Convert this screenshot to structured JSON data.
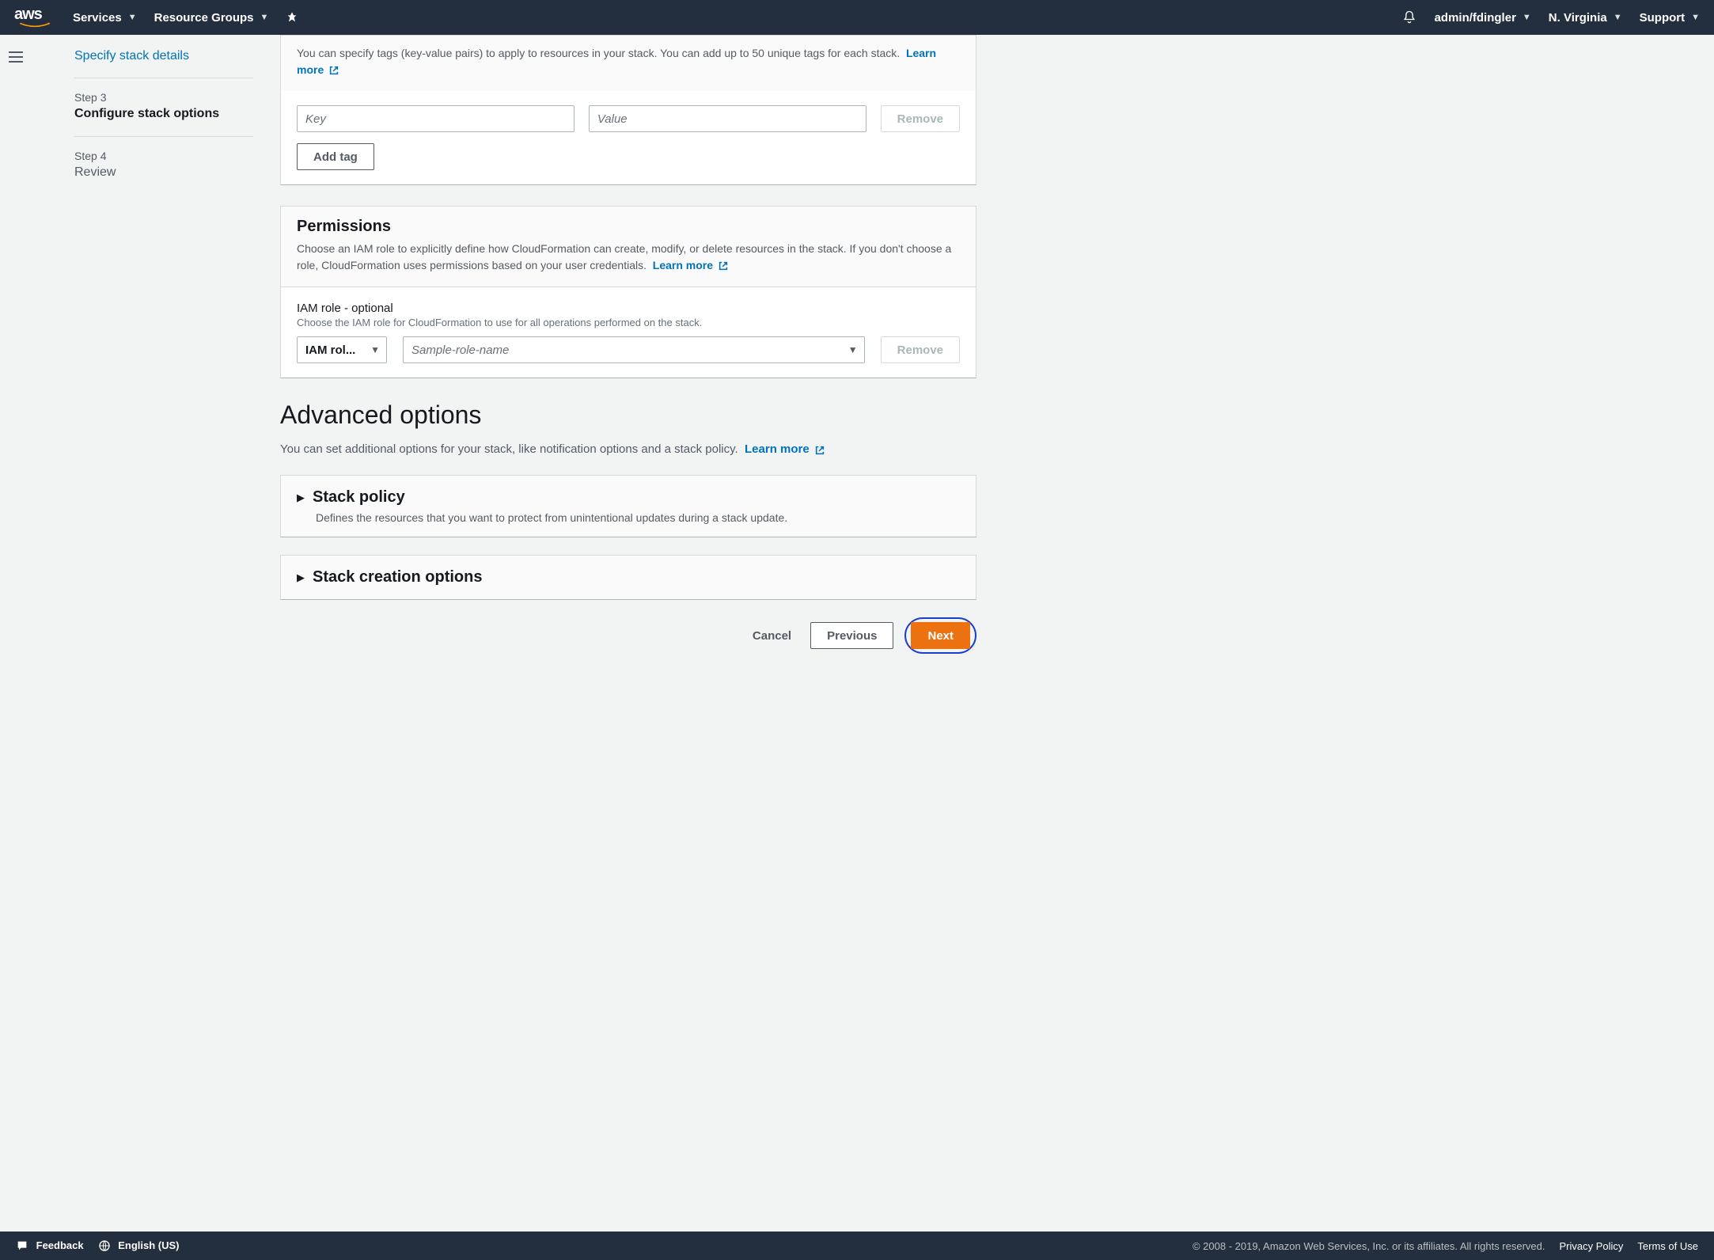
{
  "topnav": {
    "services": "Services",
    "resourceGroups": "Resource Groups",
    "user": "admin/fdingler",
    "region": "N. Virginia",
    "support": "Support"
  },
  "wizard": {
    "step2": {
      "num": "",
      "title": "Specify stack details"
    },
    "step3": {
      "num": "Step 3",
      "title": "Configure stack options"
    },
    "step4": {
      "num": "Step 4",
      "title": "Review"
    }
  },
  "tags": {
    "desc": "You can specify tags (key-value pairs) to apply to resources in your stack. You can add up to 50 unique tags for each stack.",
    "learn": "Learn more",
    "keyPlaceholder": "Key",
    "valuePlaceholder": "Value",
    "remove": "Remove",
    "addTag": "Add tag"
  },
  "permissions": {
    "title": "Permissions",
    "desc": "Choose an IAM role to explicitly define how CloudFormation can create, modify, or delete resources in the stack. If you don't choose a role, CloudFormation uses permissions based on your user credentials.",
    "learn": "Learn more",
    "fieldLabel": "IAM role - optional",
    "fieldHint": "Choose the IAM role for CloudFormation to use for all operations performed on the stack.",
    "selectorText": "IAM rol...",
    "namePlaceholder": "Sample-role-name",
    "remove": "Remove"
  },
  "advanced": {
    "title": "Advanced options",
    "sub": "You can set additional options for your stack, like notification options and a stack policy.",
    "learn": "Learn more",
    "stackPolicy": {
      "title": "Stack policy",
      "desc": "Defines the resources that you want to protect from unintentional updates during a stack update."
    },
    "creationOptions": {
      "title": "Stack creation options"
    }
  },
  "actions": {
    "cancel": "Cancel",
    "previous": "Previous",
    "next": "Next"
  },
  "footer": {
    "feedback": "Feedback",
    "language": "English (US)",
    "copyright": "© 2008 - 2019, Amazon Web Services, Inc. or its affiliates. All rights reserved.",
    "privacy": "Privacy Policy",
    "terms": "Terms of Use"
  }
}
